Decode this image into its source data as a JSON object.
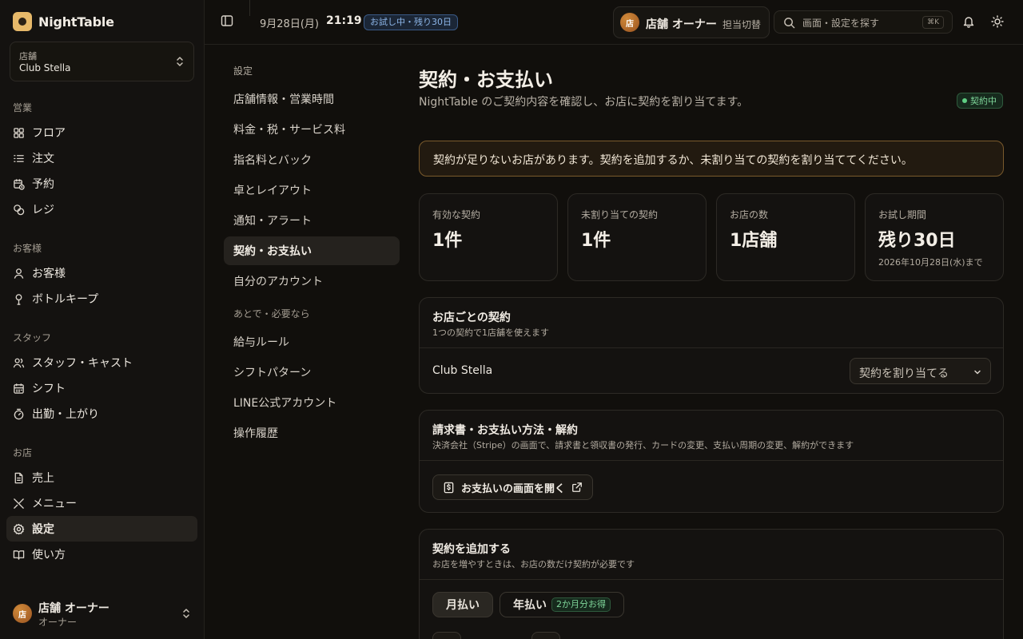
{
  "sidebar": {
    "brand": "NightTable",
    "store_switch": {
      "label": "店舗",
      "value": "Club Stella"
    },
    "sections": [
      "営業",
      "お客様",
      "スタッフ",
      "お店"
    ],
    "items": [
      {
        "label": "フロア",
        "icon": "grid-icon"
      },
      {
        "label": "注文",
        "icon": "list-icon"
      },
      {
        "label": "予約",
        "icon": "calendar-clock-icon"
      },
      {
        "label": "レジ",
        "icon": "coins-icon"
      },
      {
        "label": "お客様",
        "icon": "user-icon"
      },
      {
        "label": "ボトルキープ",
        "icon": "bottle-icon"
      },
      {
        "label": "スタッフ・キャスト",
        "icon": "users-icon"
      },
      {
        "label": "シフト",
        "icon": "calendar-icon"
      },
      {
        "label": "出勤・上がり",
        "icon": "timer-icon"
      },
      {
        "label": "売上",
        "icon": "document-icon"
      },
      {
        "label": "メニュー",
        "icon": "utensils-icon"
      },
      {
        "label": "設定",
        "icon": "gear-icon",
        "active": true
      },
      {
        "label": "使い方",
        "icon": "book-icon"
      }
    ],
    "user": {
      "avatar": "店",
      "name": "店舗 オーナー",
      "role": "オーナー"
    }
  },
  "topbar": {
    "date": "9月28日(月)",
    "time": "21:19",
    "trial_badge": "お試し中・残り30日",
    "owner": {
      "avatar": "店",
      "name": "店舗 オーナー",
      "switch": "担当切替"
    },
    "search": {
      "placeholder": "画面・設定を探す",
      "shortcut": "⌘K"
    }
  },
  "settings_nav": {
    "heading": "設定",
    "items": [
      "店舗情報・営業時間",
      "料金・税・サービス料",
      "指名料とバック",
      "卓とレイアウト",
      "通知・アラート",
      "契約・お支払い",
      "自分のアカウント"
    ],
    "active_index": 5,
    "sub_heading": "あとで・必要なら",
    "sub_items": [
      "給与ルール",
      "シフトパターン",
      "LINE公式アカウント",
      "操作履歴"
    ]
  },
  "main": {
    "title": "契約・お支払い",
    "subtitle": "NightTable のご契約内容を確認し、お店に契約を割り当てます。",
    "status": "契約中",
    "alert": "契約が足りないお店があります。契約を追加するか、未割り当ての契約を割り当ててください。",
    "stats": [
      {
        "label": "有効な契約",
        "value": "1件"
      },
      {
        "label": "未割り当ての契約",
        "value": "1件"
      },
      {
        "label": "お店の数",
        "value": "1店舗"
      },
      {
        "label": "お試し期間",
        "value": "残り30日",
        "note": "2026年10月28日(水)まで"
      }
    ],
    "per_store": {
      "title": "お店ごとの契約",
      "subtitle": "1つの契約で1店舗を使えます",
      "store": "Club Stella",
      "select": "契約を割り当てる"
    },
    "billing": {
      "title": "請求書・お支払い方法・解約",
      "subtitle": "決済会社（Stripe）の画面で、請求書と領収書の発行、カードの変更、支払い周期の変更、解約ができます",
      "button": "お支払いの画面を開く"
    },
    "add": {
      "title": "契約を追加する",
      "subtitle": "お店を増やすときは、お店の数だけ契約が必要です",
      "monthly": "月払い",
      "yearly": "年払い",
      "yearly_badge": "2か月分お得"
    }
  },
  "colors": {
    "accent": "#e7b96a",
    "status_green": "#7fd69a",
    "trial_blue": "#8db6e8",
    "alert_border": "#7a5a2c"
  }
}
